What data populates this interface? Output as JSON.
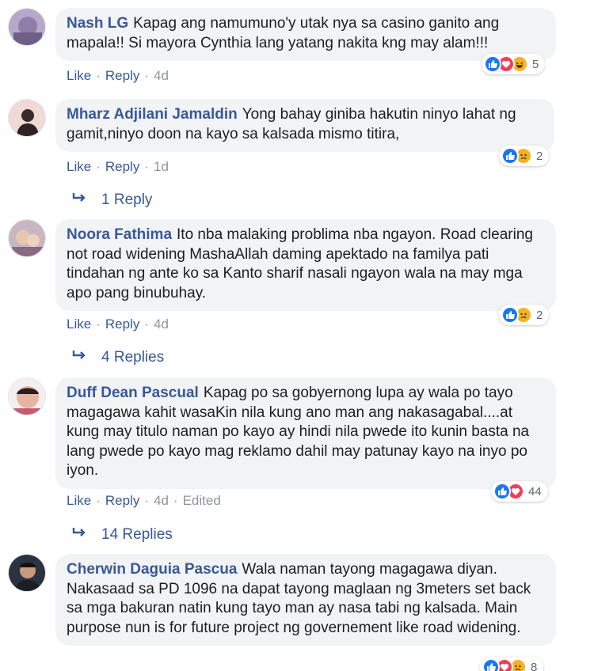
{
  "comments": [
    {
      "author": "Nash LG",
      "text": "Kapag ang namumuno'y utak nya sa casino ganito ang mapala!! Si mayora Cynthia lang yatang nakita kng may alam!!!",
      "like": "Like",
      "reply": "Reply",
      "time": "4d",
      "reactions": [
        "like",
        "love",
        "haha"
      ],
      "reaction_count": "5"
    },
    {
      "author": "Mharz Adjilani Jamaldin",
      "text": "Yong bahay giniba hakutin ninyo lahat ng gamit,ninyo doon na kayo sa kalsada mismo titira,",
      "like": "Like",
      "reply": "Reply",
      "time": "1d",
      "reactions": [
        "like",
        "sad"
      ],
      "reaction_count": "2",
      "replies_label": "1 Reply"
    },
    {
      "author": "Noora Fathima",
      "text": "Ito nba malaking problima nba ngayon. Road clearing not road widening MashaAllah daming apektado na familya pati tindahan ng ante ko sa Kanto sharif nasali ngayon wala na may mga apo pang binubuhay.",
      "like": "Like",
      "reply": "Reply",
      "time": "4d",
      "reactions": [
        "like",
        "sad"
      ],
      "reaction_count": "2",
      "replies_label": "4 Replies"
    },
    {
      "author": "Duff Dean Pascual",
      "text": "Kapag po sa gobyernong lupa ay wala po tayo magagawa kahit wasaKin nila kung ano man ang nakasagabal....at kung may titulo naman po kayo ay hindi nila pwede ito kunin basta na lang pwede po kayo mag reklamo dahil may patunay kayo na inyo po iyon.",
      "like": "Like",
      "reply": "Reply",
      "time": "4d",
      "edited": "Edited",
      "reactions": [
        "like",
        "love"
      ],
      "reaction_count": "44",
      "replies_label": "14 Replies"
    },
    {
      "author": "Cherwin Daguia Pascua",
      "text": "Wala naman tayong magagawa diyan. Nakasaad sa PD 1096 na dapat tayong maglaan ng 3meters set back sa mga bakuran natin kung tayo man ay nasa tabi ng kalsada. Main purpose nun is for future project ng governement like road widening.",
      "reactions": [
        "like",
        "love",
        "sad"
      ],
      "reaction_count": "8"
    }
  ],
  "colors": {
    "author": "#385898",
    "bubble": "#f2f3f5",
    "like_react": "#1877f2",
    "love_react": "#f33e58",
    "haha_react": "#f7b125"
  }
}
